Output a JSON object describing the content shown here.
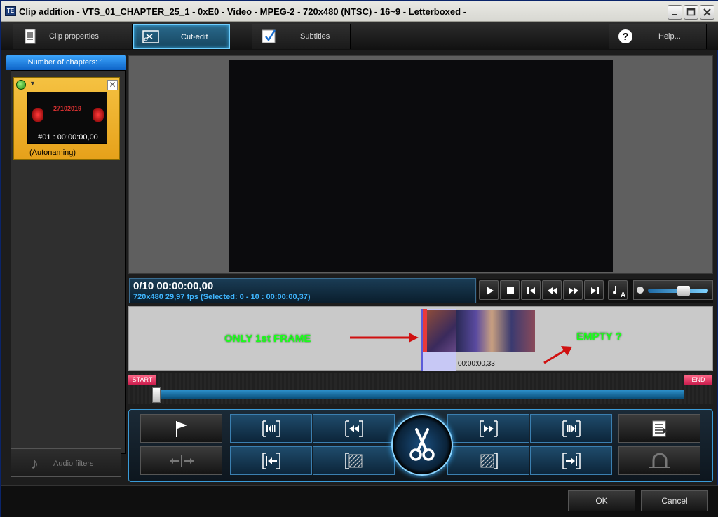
{
  "window": {
    "title": "Clip addition - VTS_01_CHAPTER_25_1 - 0xE0 - Video - MPEG-2 - 720x480 (NTSC) - 16~9 - Letterboxed -",
    "icon_text": "TE"
  },
  "tabs": [
    {
      "label": "Clip properties"
    },
    {
      "label": "Cut-edit"
    },
    {
      "label": "Subtitles"
    },
    {
      "label": "Help..."
    }
  ],
  "chapters": {
    "header": "Number of chapters: 1",
    "items": [
      {
        "timecode": "#01 : 00:00:00,00",
        "name": "(Autonaming)",
        "thumb_text": "27102019"
      }
    ]
  },
  "audio_filters_label": "Audio filters",
  "status": {
    "frame_time": "0/10  00:00:00,00",
    "details": "720x480 29,97  fps  (Selected: 0 - 10 : 00:00:00,37)"
  },
  "timeline": {
    "frame_timecode": "00:00:00,33",
    "annotation_left": "ONLY 1st FRAME",
    "annotation_right": "EMPTY ?",
    "annotation_color": "#1aff1a"
  },
  "range": {
    "start_label": "START",
    "end_label": "END"
  },
  "buttons": {
    "ok": "OK",
    "cancel": "Cancel"
  },
  "colors": {
    "accent": "#3fb6ff",
    "chapter_card": "#f0b830",
    "arrow_red": "#d01010"
  }
}
